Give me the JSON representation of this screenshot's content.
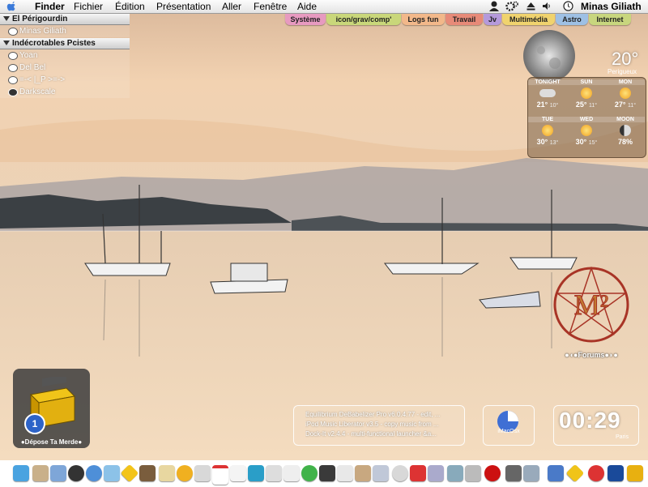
{
  "menubar": {
    "app": "Finder",
    "items": [
      "Fichier",
      "Édition",
      "Présentation",
      "Aller",
      "Fenêtre",
      "Aide"
    ],
    "user": "Minas Giliath"
  },
  "tabs": [
    {
      "label": "Système",
      "color": "#e79ac0"
    },
    {
      "label": "icon/grav/comp'",
      "color": "#c9d77a"
    },
    {
      "label": "Logs fun",
      "color": "#f2b88a"
    },
    {
      "label": "Travail",
      "color": "#e78a78"
    },
    {
      "label": "Jv",
      "color": "#b59adb"
    },
    {
      "label": "Multimédia",
      "color": "#f0d36e"
    },
    {
      "label": "Astro",
      "color": "#9ec0e4"
    },
    {
      "label": "Internet",
      "color": "#c8d67e"
    }
  ],
  "buddylist": {
    "groups": [
      {
        "name": "El Périgourdin",
        "members": [
          "Minas Giliath"
        ]
      },
      {
        "name": "Indécrotables Pcistes",
        "members": [
          "Yoan",
          "Del Bel",
          "=-< |_P >=->",
          "Darkscale"
        ]
      }
    ]
  },
  "weather": {
    "current_temp": "20°",
    "city": "Perigueux",
    "days": [
      {
        "label": "TONIGHT",
        "high": "21°",
        "low": "10°"
      },
      {
        "label": "SUN",
        "high": "25°",
        "low": "11°"
      },
      {
        "label": "MON",
        "high": "27°",
        "low": "11°"
      },
      {
        "label": "TUE",
        "high": "30°",
        "low": "13°"
      },
      {
        "label": "WED",
        "high": "30°",
        "low": "15°"
      },
      {
        "label": "MOON",
        "value": "78%"
      }
    ]
  },
  "forums_label": "●◖●Forums●◗●",
  "dropbox": {
    "label": "●Dépose Ta Merde●",
    "badge": "1"
  },
  "itunes": {
    "lines": [
      "Equilibrium DeBabelizer Pro v6.0.4.77 - edit, ...",
      "iPod Music Liberator v3.5 - copy music from ...",
      "Dock-It v2.4.4 - multi-functional launcher &a..."
    ]
  },
  "imac_label": "iMacOsx",
  "clock": {
    "time": "00:29",
    "city": "Paris"
  },
  "dock": {
    "icons": [
      "finder-icon",
      "preview-icon",
      "itunes-icon",
      "quicktime-icon",
      "safari-icon",
      "mail-icon",
      "caution-icon",
      "photo-icon",
      "notes-icon",
      "sunflower-icon",
      "maps-icon",
      "calendar-icon",
      "textedit-icon",
      "uwrite-icon",
      "clone-icon",
      "stormtrooper-icon",
      "skype-icon",
      "cd-icon",
      "package-icon",
      "address-icon",
      "preview2-icon",
      "font-icon",
      "disk-icon",
      "search-icon",
      "tools-icon",
      "camera-icon",
      "record-icon",
      "music-icon",
      "folder-icon",
      "warning-icon",
      "settings-icon",
      "utility-icon",
      "trash-icon"
    ]
  }
}
